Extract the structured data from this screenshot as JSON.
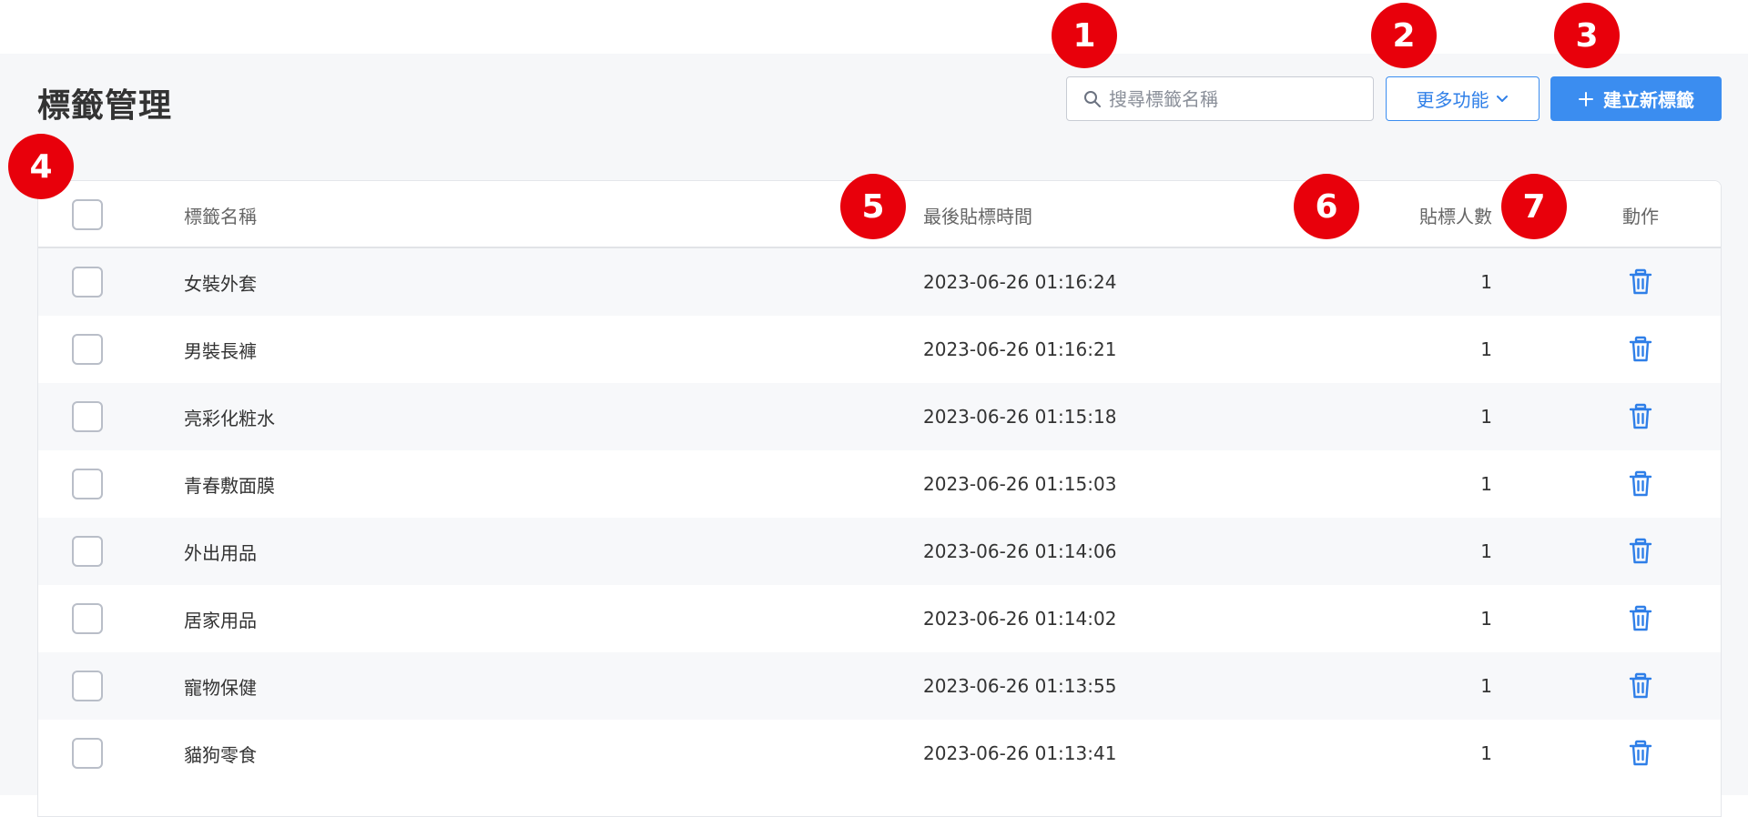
{
  "page": {
    "title": "標籤管理"
  },
  "toolbar": {
    "search_placeholder": "搜尋標籤名稱",
    "more_label": "更多功能",
    "new_label": "建立新標籤",
    "accent": "#3b8df0"
  },
  "table": {
    "columns": {
      "name": "標籤名稱",
      "last_time": "最後貼標時間",
      "count": "貼標人數",
      "action": "動作"
    },
    "rows": [
      {
        "name": "女裝外套",
        "time": "2023-06-26 01:16:24",
        "count": "1"
      },
      {
        "name": "男裝長褲",
        "time": "2023-06-26 01:16:21",
        "count": "1"
      },
      {
        "name": "亮彩化粧水",
        "time": "2023-06-26 01:15:18",
        "count": "1"
      },
      {
        "name": "青春敷面膜",
        "time": "2023-06-26 01:15:03",
        "count": "1"
      },
      {
        "name": "外出用品",
        "time": "2023-06-26 01:14:06",
        "count": "1"
      },
      {
        "name": "居家用品",
        "time": "2023-06-26 01:14:02",
        "count": "1"
      },
      {
        "name": "寵物保健",
        "time": "2023-06-26 01:13:55",
        "count": "1"
      },
      {
        "name": "貓狗零食",
        "time": "2023-06-26 01:13:41",
        "count": "1"
      }
    ]
  },
  "annotations": [
    "1",
    "2",
    "3",
    "4",
    "5",
    "6",
    "7"
  ],
  "colors": {
    "badge": "#e8000b",
    "trash_icon": "#2f7fe8"
  }
}
